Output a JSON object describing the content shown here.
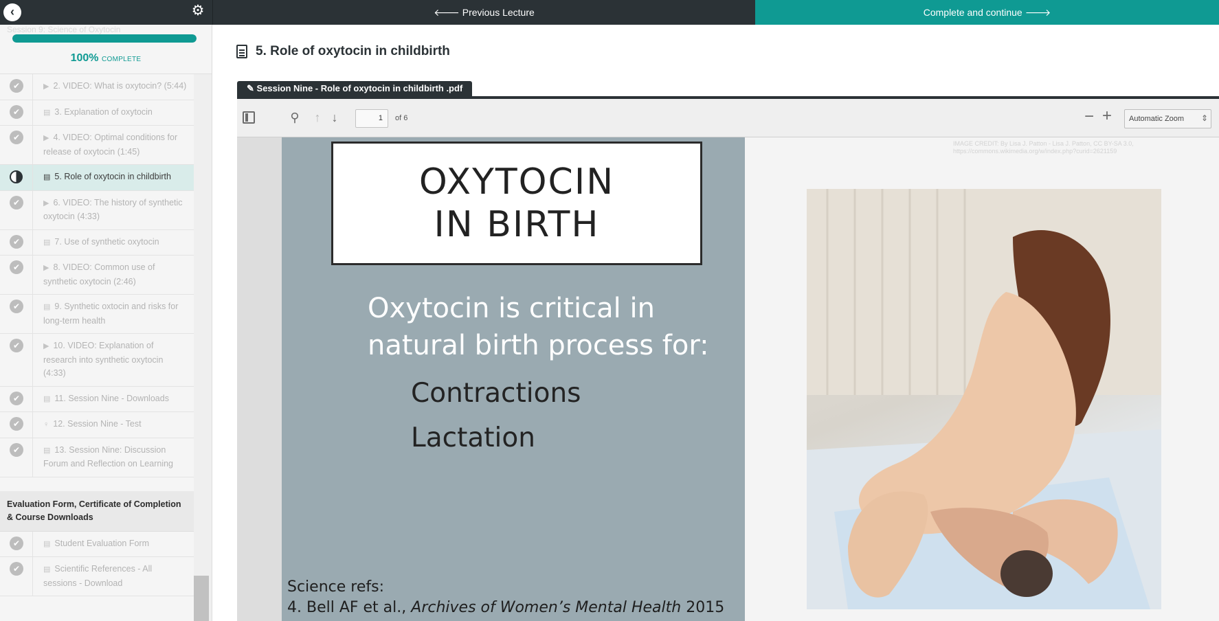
{
  "topbar": {
    "prev_label": "Previous Lecture",
    "next_label": "Complete and continue",
    "prev_icon": "arrow-left-icon",
    "next_icon": "arrow-right-icon",
    "accent_color": "#0f9a93",
    "dark_color": "#2b3236"
  },
  "sidebar": {
    "faded_section_title": "Session 9: Science of Oxytocin",
    "progress_percent": 100,
    "progress_value": "100%",
    "progress_suffix": "COMPLETE",
    "items": [
      {
        "number": "2.",
        "icon": "video-icon",
        "label": "VIDEO: What is oxytocin? (5:44)"
      },
      {
        "number": "3.",
        "icon": "document-icon",
        "label": "Explanation of oxytocin"
      },
      {
        "number": "4.",
        "icon": "video-icon",
        "label": "VIDEO: Optimal conditions for release of oxytocin (1:45)"
      },
      {
        "number": "5.",
        "icon": "document-icon",
        "label": "Role of oxytocin in childbirth",
        "active": true
      },
      {
        "number": "6.",
        "icon": "video-icon",
        "label": "VIDEO: The history of synthetic oxytocin (4:33)"
      },
      {
        "number": "7.",
        "icon": "document-icon",
        "label": "Use of synthetic oxytocin"
      },
      {
        "number": "8.",
        "icon": "video-icon",
        "label": "VIDEO: Common use of synthetic oxytocin (2:46)"
      },
      {
        "number": "9.",
        "icon": "document-icon",
        "label": "Synthetic oxtocin and risks for long-term health"
      },
      {
        "number": "10.",
        "icon": "video-icon",
        "label": "VIDEO: Explanation of research into synthetic oxytocin (4:33)"
      },
      {
        "number": "11.",
        "icon": "document-icon",
        "label": "Session Nine - Downloads"
      },
      {
        "number": "12.",
        "icon": "quiz-icon",
        "label": "Session Nine - Test"
      },
      {
        "number": "13.",
        "icon": "document-icon",
        "label": "Session Nine: Discussion Forum and Reflection on Learning"
      }
    ],
    "next_section": {
      "title": "Evaluation Form, Certificate of Completion & Course Downloads",
      "items": [
        {
          "icon": "document-icon",
          "label": "Student Evaluation Form"
        },
        {
          "icon": "document-icon",
          "label": "Scientific References - All sessions - Download"
        }
      ]
    }
  },
  "main": {
    "lecture_title": "5. Role of oxytocin in childbirth",
    "attachment_label": "Session Nine - Role of oxytocin in childbirth .pdf"
  },
  "pdf_toolbar": {
    "page_number": "1",
    "page_total": "of 6",
    "zoom": "Automatic Zoom"
  },
  "slide": {
    "title_line1": "OXYTOCIN",
    "title_line2": "IN BIRTH",
    "critical_text": "Oxytocin is critical in natural birth process for:",
    "bullet1": "Contractions",
    "bullet2": "Lactation",
    "refs_heading": "Science refs:",
    "ref1_prefix": "4. Bell AF et al.,",
    "ref1_journal": "Archives of Women’s Mental Health",
    "ref1_year": "2015",
    "image_credit_line1": "IMAGE CREDIT: By Lisa J. Patton - Lisa J. Patton, CC BY-SA 3.0,",
    "image_credit_line2": "https://commons.wikimedia.org/w/index.php?curid=2621159"
  }
}
